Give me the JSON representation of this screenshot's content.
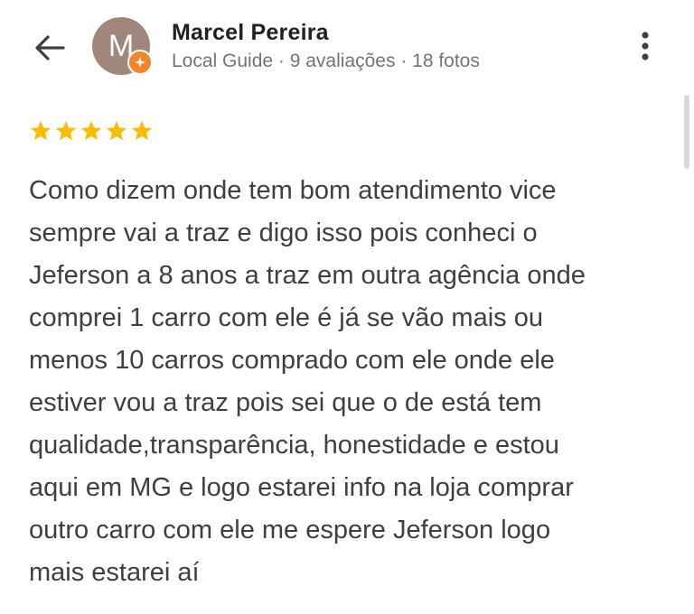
{
  "author": {
    "name": "Marcel Pereira",
    "initial": "M",
    "meta": "Local Guide · 9 avaliações · 18 fotos",
    "avatar_color": "#a1877b",
    "badge_color": "#f4852a"
  },
  "icons": {
    "back": "arrow-back-icon",
    "more": "more-vert-icon",
    "badge": "local-guide-star-icon",
    "star": "star-icon"
  },
  "review": {
    "rating": 5,
    "max_rating": 5,
    "star_color": "#fbbc04",
    "text": "Como dizem onde tem bom atendimento vice\nsempre vai a traz e digo isso pois conheci o\nJeferson a 8 anos a traz em outra agência onde\ncomprei 1 carro com ele é já se vão mais ou\nmenos 10 carros comprado com ele onde ele\nestiver vou a traz pois sei que o de está tem\nqualidade,transparência, honestidade e estou\naqui em MG e logo estarei info na loja comprar\noutro carro com ele me espere Jeferson logo\nmais estarei aí"
  }
}
